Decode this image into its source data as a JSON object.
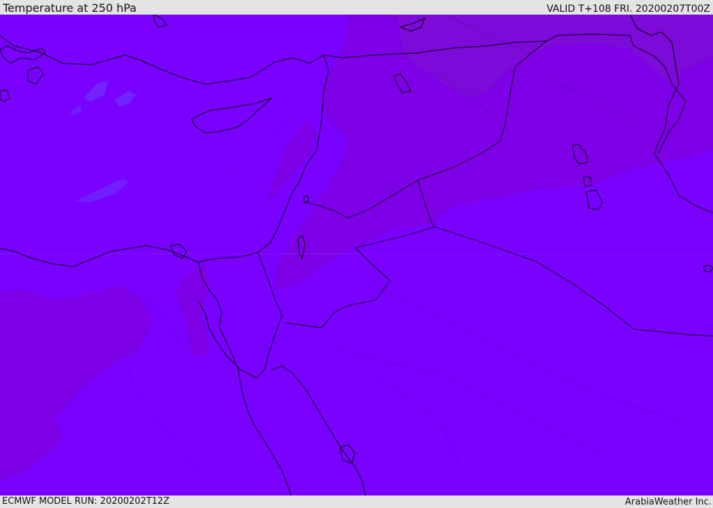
{
  "header": {
    "title": "Temperature at 250 hPa",
    "valid": "VALID T+108 FRI. 20200207T00Z"
  },
  "footer": {
    "model_run": "ECMWF MODEL RUN: 20200202T12Z",
    "credit": "ArabiaWeather Inc."
  },
  "map": {
    "field": "temperature-250hPa",
    "colors": {
      "base": "#7a00ff",
      "warm_band": "#7d00e6",
      "warm_band_north": "#7c0ad8",
      "cool_patch": "#6a3cff",
      "coastline": "#000000"
    }
  }
}
